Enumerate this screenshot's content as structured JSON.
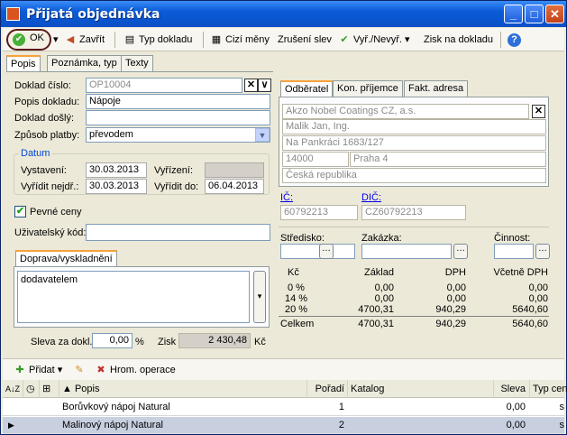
{
  "window": {
    "title": "Přijatá objednávka"
  },
  "toolbar": {
    "ok": "OK",
    "close": "Zavřít",
    "doc_type": "Typ dokladu",
    "foreign_currency": "Cizí měny",
    "cancel_discount": "Zrušení slev",
    "select_deselect": "Vyř./Nevyř.",
    "profit": "Zisk na dokladu"
  },
  "left_tabs": [
    "Popis",
    "Poznámka, typ",
    "Texty"
  ],
  "form": {
    "doc_number_label": "Doklad číslo:",
    "doc_number": "OP10004",
    "doc_desc_label": "Popis dokladu:",
    "doc_desc": "Nápoje",
    "doc_received_label": "Doklad došlý:",
    "doc_received": "",
    "payment_label": "Způsob platby:",
    "payment": "převodem"
  },
  "date_group": {
    "title": "Datum",
    "issued_label": "Vystavení:",
    "issued": "30.03.2013",
    "settled_label": "Vyřízení:",
    "settled": "",
    "due_earliest_label": "Vyřídit nejdř.:",
    "due_earliest": "30.03.2013",
    "due_until_label": "Vyřídit do:",
    "due_until": "06.04.2013"
  },
  "fixed_prices": "Pevné ceny",
  "user_code_label": "Uživatelský kód:",
  "shipping": {
    "tab": "Doprava/vyskladnění",
    "text": "dodavatelem"
  },
  "discount_label": "Sleva za dokl.:",
  "discount": "0,00",
  "discount_unit": "%",
  "profit_label": "Zisk",
  "profit": "2 430,48",
  "profit_unit": "Kč",
  "right_tabs": [
    "Odběratel",
    "Kon. příjemce",
    "Fakt. adresa"
  ],
  "customer": {
    "name": "Akzo Nobel Coatings CZ, a.s.",
    "contact": "Malik Jan, Ing.",
    "street": "Na Pankráci 1683/127",
    "zip": "14000",
    "city": "Praha 4",
    "country": "Česká republika"
  },
  "ids": {
    "ic_label": "IČ:",
    "ic": "60792213",
    "dic_label": "DIČ:",
    "dic": "CZ60792213"
  },
  "centers": {
    "center_label": "Středisko:",
    "order_label": "Zakázka:",
    "activity_label": "Činnost:"
  },
  "summary": {
    "headers": [
      "Kč",
      "Základ",
      "DPH",
      "Včetně DPH"
    ],
    "rows": [
      [
        "0 %",
        "0,00",
        "0,00",
        "0,00"
      ],
      [
        "14 %",
        "0,00",
        "0,00",
        "0,00"
      ],
      [
        "20 %",
        "4700,31",
        "940,29",
        "5640,60"
      ],
      [
        "Celkem",
        "4700,31",
        "940,29",
        "5640,60"
      ]
    ]
  },
  "bottom_toolbar": {
    "add": "Přidat",
    "bulk_ops": "Hrom. operace"
  },
  "grid": {
    "headers": {
      "desc": "Popis",
      "order": "Pořadí",
      "catalog": "Katalog",
      "discount": "Sleva",
      "price_type": "Typ ceny"
    },
    "rows": [
      {
        "desc": "Borůvkový nápoj Natural",
        "order": "1",
        "catalog": "",
        "discount": "0,00",
        "price_type": "s"
      },
      {
        "desc": "Malinový nápoj Natural",
        "order": "2",
        "catalog": "",
        "discount": "0,00",
        "price_type": "s"
      }
    ]
  }
}
